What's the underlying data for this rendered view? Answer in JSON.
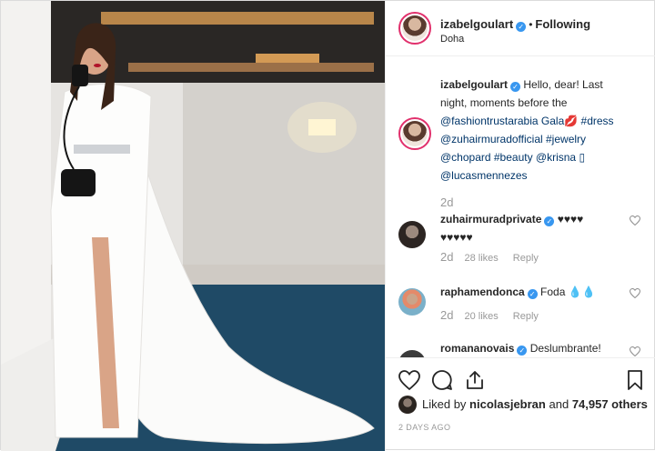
{
  "header": {
    "username": "izabelgoulart",
    "follow_status": "Following",
    "location": "Doha"
  },
  "caption": {
    "username": "izabelgoulart",
    "lines": [
      "Hello, dear! Last",
      "night, moments before the",
      "@fashiontrustarabia Gala💋 #dress",
      "@zuhairmuradofficial #jewelry",
      "@chopard #beauty @krisna ▯",
      "@lucasmennezes"
    ],
    "time": "2d"
  },
  "comments": [
    {
      "username": "zuhairmuradprivate",
      "text": "♥♥♥♥",
      "text2": "♥♥♥♥♥",
      "time": "2d",
      "likes": "28 likes",
      "reply": "Reply"
    },
    {
      "username": "raphamendonca",
      "text": "Foda 💧💧",
      "time": "2d",
      "likes": "20 likes",
      "reply": "Reply"
    },
    {
      "username": "romananovais",
      "text": "Deslumbrante!"
    }
  ],
  "likes_line": {
    "prefix": "Liked by",
    "user": "nicolasjebran",
    "and": "and",
    "others": "74,957 others"
  },
  "date": "2 DAYS AGO",
  "icons": [
    "heart-icon",
    "comment-icon",
    "share-icon",
    "bookmark-icon",
    "verified-icon"
  ],
  "colors": {
    "link": "#003569",
    "verified": "#3897f0",
    "story_ring": "#e1306c"
  }
}
